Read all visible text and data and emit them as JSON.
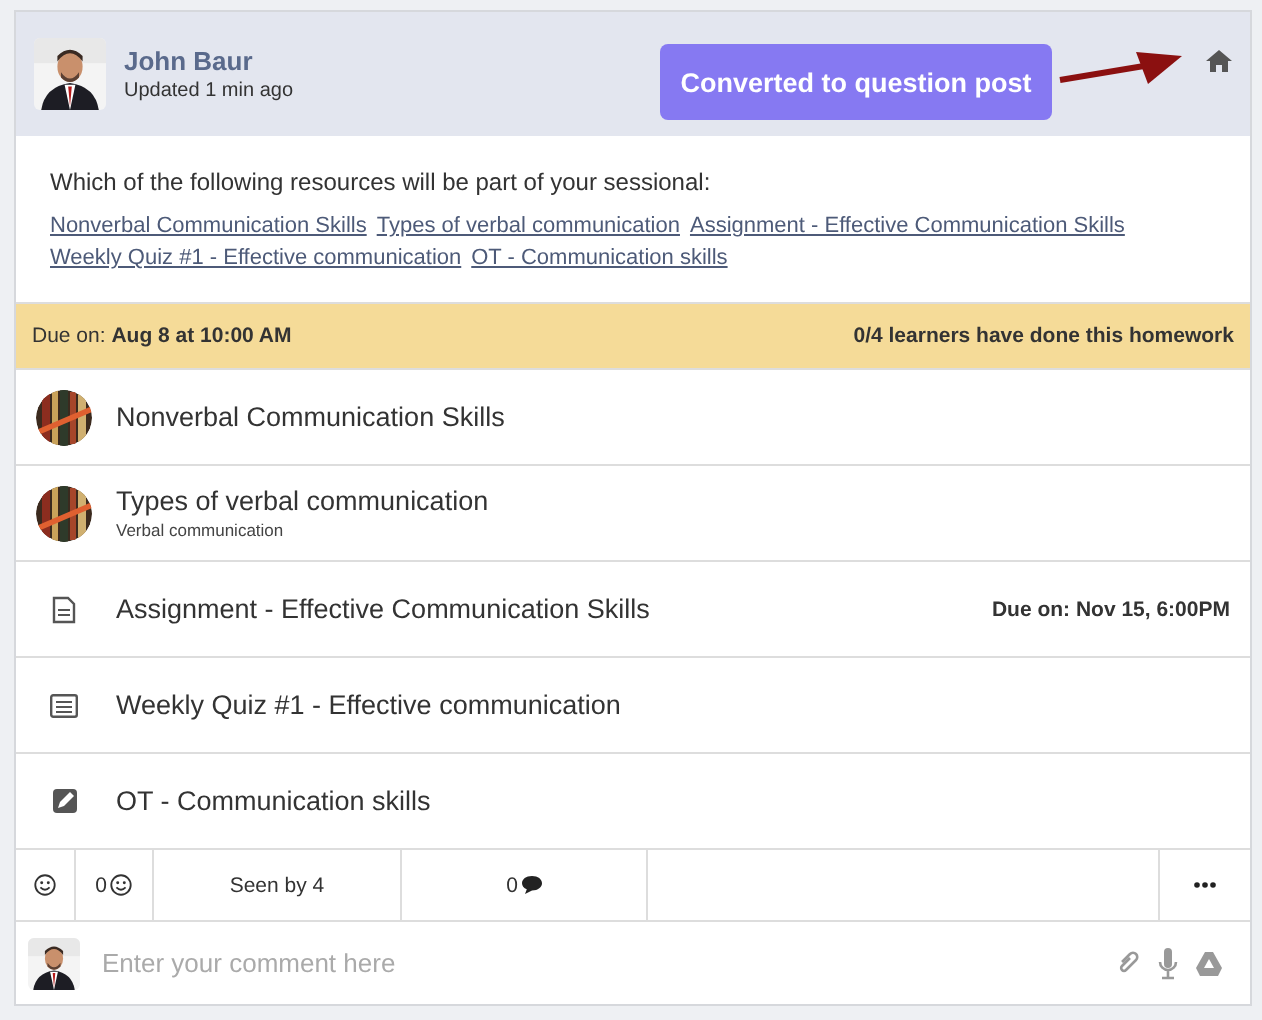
{
  "post": {
    "author": "John Baur",
    "updated": "Updated 1 min ago",
    "annotation": "Converted to question post",
    "question": "Which of the following resources will be part of your sessional:",
    "links": [
      "Nonverbal Communication Skills",
      "Types of verbal communication",
      "Assignment - Effective Communication Skills",
      "Weekly Quiz #1 - Effective communication",
      "OT - Communication skills"
    ]
  },
  "due_bar": {
    "label": "Due on:",
    "date": "Aug 8 at 10:00 AM",
    "progress": "0/4 learners have done this homework"
  },
  "resources": [
    {
      "kind": "book",
      "title": "Nonverbal Communication Skills"
    },
    {
      "kind": "book",
      "title": "Types of verbal communication",
      "subtitle": "Verbal communication"
    },
    {
      "kind": "document",
      "title": "Assignment - Effective Communication Skills",
      "due_label": "Due on:",
      "due": "Nov 15, 6:00PM"
    },
    {
      "kind": "quiz",
      "title": "Weekly Quiz #1 - Effective communication"
    },
    {
      "kind": "edit",
      "title": "OT - Communication skills"
    }
  ],
  "footer": {
    "likes": "0",
    "seen": "Seen by 4",
    "comments": "0"
  },
  "comment": {
    "placeholder": "Enter your comment here"
  }
}
